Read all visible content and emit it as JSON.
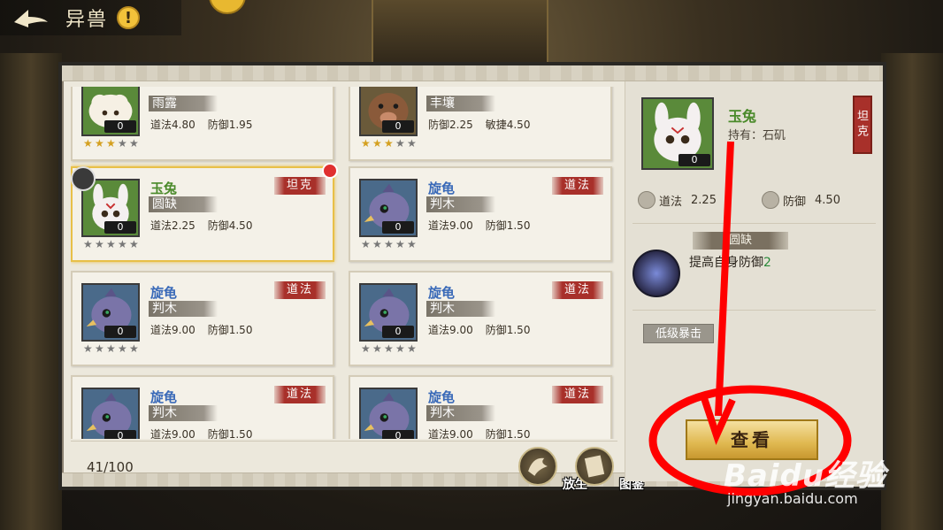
{
  "header": {
    "title": "异兽",
    "info": "!"
  },
  "pets": [
    {
      "name": "",
      "skill": "雨露",
      "stats": [
        "道法4.80",
        "防御1.95"
      ],
      "stars": 3,
      "level": "0",
      "tag": "",
      "color": "",
      "portrait": "sheep"
    },
    {
      "name": "",
      "skill": "丰壤",
      "stats": [
        "防御2.25",
        "敏捷4.50"
      ],
      "stars": 3,
      "level": "0",
      "tag": "",
      "color": "",
      "portrait": "boar"
    },
    {
      "name": "玉兔",
      "skill": "圆缺",
      "stats": [
        "道法2.25",
        "防御4.50"
      ],
      "stars": 0,
      "level": "0",
      "tag": "坦克",
      "color": "green",
      "portrait": "rabbit",
      "selected": true
    },
    {
      "name": "旋龟",
      "skill": "判木",
      "stats": [
        "道法9.00",
        "防御1.50"
      ],
      "stars": 0,
      "level": "0",
      "tag": "道法",
      "color": "blue",
      "portrait": "bird"
    },
    {
      "name": "旋龟",
      "skill": "判木",
      "stats": [
        "道法9.00",
        "防御1.50"
      ],
      "stars": 0,
      "level": "0",
      "tag": "道法",
      "color": "blue",
      "portrait": "bird"
    },
    {
      "name": "旋龟",
      "skill": "判木",
      "stats": [
        "道法9.00",
        "防御1.50"
      ],
      "stars": 0,
      "level": "0",
      "tag": "道法",
      "color": "blue",
      "portrait": "bird"
    },
    {
      "name": "旋龟",
      "skill": "判木",
      "stats": [
        "道法9.00",
        "防御1.50"
      ],
      "stars": 0,
      "level": "0",
      "tag": "道法",
      "color": "blue",
      "portrait": "bird"
    },
    {
      "name": "旋龟",
      "skill": "判木",
      "stats": [
        "道法9.00",
        "防御1.50"
      ],
      "stars": 0,
      "level": "0",
      "tag": "道法",
      "color": "blue",
      "portrait": "bird"
    }
  ],
  "footer": {
    "count": "41/100",
    "release_label": "放生",
    "atlas_label": "图鉴"
  },
  "detail": {
    "name": "玉兔",
    "owner": "持有：石矶",
    "tag": "坦克",
    "level": "0",
    "stat1_label": "道法",
    "stat1_value": "2.25",
    "stat2_label": "防御",
    "stat2_value": "4.50",
    "skill_title": "圆缺",
    "skill_desc_prefix": "提高自身防御",
    "skill_desc_num": "2",
    "passive": "低级暴击",
    "view_label": "查看"
  },
  "watermark": {
    "brand": "Baidu经验",
    "url": "jingyan.baidu.com"
  },
  "colors": {
    "accent_red": "#a8302a",
    "name_green": "#4a8a2a",
    "name_blue": "#3a6ab8",
    "gold": "#e0b850",
    "annotation": "#ff0000"
  }
}
